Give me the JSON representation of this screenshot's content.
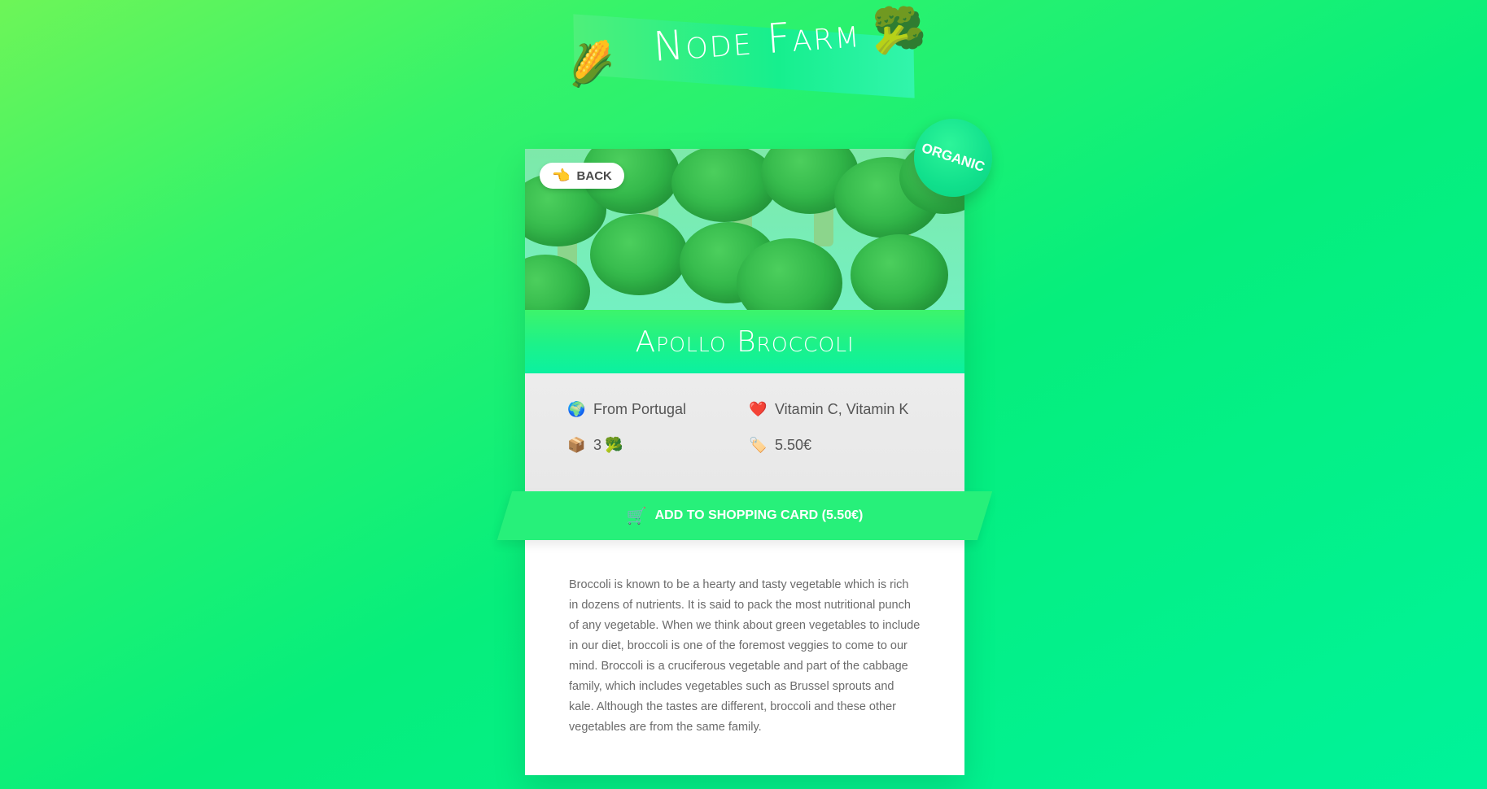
{
  "header": {
    "title": "Node Farm",
    "corn_icon": "🌽",
    "broccoli_icon": "🥦"
  },
  "product": {
    "back_label": "BACK",
    "back_icon": "👈",
    "organic_label": "ORGANIC",
    "name": "Apollo Broccoli",
    "from": "From Portugal",
    "nutrients": "Vitamin C, Vitamin K",
    "quantity": "3",
    "quantity_icon": "🥦",
    "price": "5.50€",
    "add_button_label": "ADD TO SHOPPING CARD (5.50€)",
    "cart_icon": "🛒",
    "description": "Broccoli is known to be a hearty and tasty vegetable which is rich in dozens of nutrients. It is said to pack the most nutritional punch of any vegetable. When we think about green vegetables to include in our diet, broccoli is one of the foremost veggies to come to our mind. Broccoli is a cruciferous vegetable and part of the cabbage family, which includes vegetables such as Brussel sprouts and kale. Although the tastes are different, broccoli and these other vegetables are from the same family."
  },
  "icons": {
    "globe": "🌍",
    "heart": "❤️",
    "box": "📦",
    "tag": "🏷️"
  },
  "colors": {
    "accent": "#27f07a",
    "text": "#555555"
  }
}
